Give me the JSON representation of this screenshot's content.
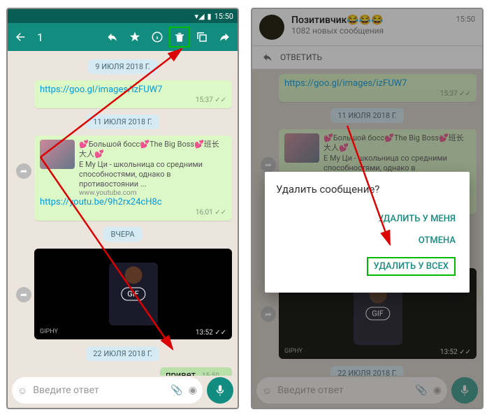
{
  "status": {
    "time": "15:50"
  },
  "toolbar": {
    "count": "1"
  },
  "dates": {
    "d1": "9 ИЮЛЯ 2018 Г.",
    "d2": "11 ИЮЛЯ 2018 Г.",
    "d3": "ВЧЕРА",
    "d4": "22 ИЮЛЯ 2018 Г."
  },
  "msg": {
    "link1": "https://goo.gl/images/izFUW7",
    "t1": "15:37",
    "prev_title": "💕Большой босс💕The Big Boss💕班长大人💕",
    "prev_desc": "Е Му Ци - школьница со средними способностями, однако в противостоянии ...",
    "prev_domain": "www.youtube.com",
    "link2": "https://youtu.be/9h2rx24cH8c",
    "t2": "16:01",
    "gif": "GIF",
    "giphy": "GIPHY",
    "gts": "13:52",
    "hello": "привет",
    "hello_ts": "15:50"
  },
  "input": {
    "placeholder": "Введите ответ"
  },
  "notif": {
    "title": "Позитивчик😂😂😂",
    "sub": "1082 новых сообщения",
    "reply": "ОТВЕТИТЬ",
    "time": "15:50"
  },
  "dialog": {
    "title": "Удалить сообщение?",
    "btn1": "УДАЛИТЬ У МЕНЯ",
    "btn2": "ОТМЕНА",
    "btn3": "УДАЛИТЬ У ВСЕХ"
  }
}
